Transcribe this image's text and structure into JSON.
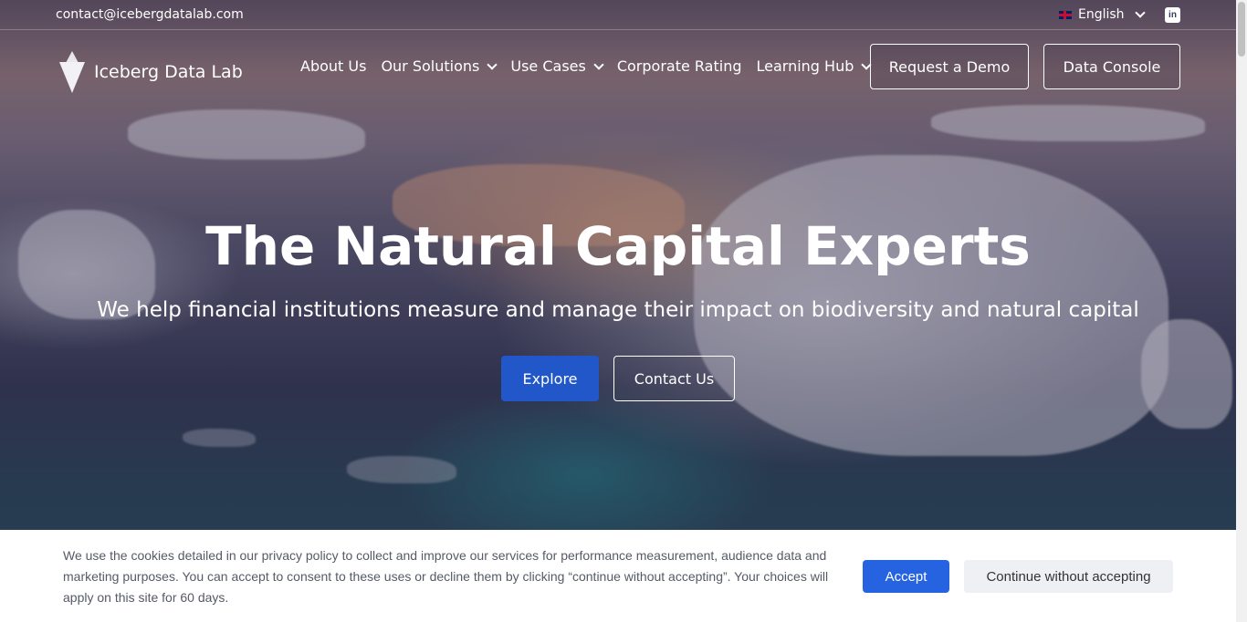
{
  "topbar": {
    "email": "contact@icebergdatalab.com",
    "language": "English",
    "language_flag": "uk-flag-icon",
    "social_icon": "linkedin-icon",
    "linkedin_glyph": "in"
  },
  "logo": {
    "text": "Iceberg Data Lab",
    "icon": "iceberg-logo-icon"
  },
  "nav": {
    "items": [
      {
        "label": "About Us",
        "dropdown": false
      },
      {
        "label": "Our Solutions",
        "dropdown": true
      },
      {
        "label": "Use Cases",
        "dropdown": true
      },
      {
        "label": "Corporate Rating",
        "dropdown": false
      },
      {
        "label": "Learning Hub",
        "dropdown": true
      }
    ],
    "demo_label": "Request a Demo",
    "console_label": "Data Console"
  },
  "hero": {
    "headline": "The Natural Capital Experts",
    "subline": "We help financial institutions measure and manage their impact on biodiversity and natural capital",
    "explore_label": "Explore",
    "contact_label": "Contact Us"
  },
  "cookie": {
    "text": "We use the cookies detailed in our privacy policy to collect and improve our services for performance measurement, audience data and marketing purposes. You can accept to consent to these uses or decline them by clicking “continue without accepting”. Your choices will apply on this site for 60 days.",
    "accept_label": "Accept",
    "decline_label": "Continue without accepting"
  },
  "colors": {
    "primary_button": "#2157c9",
    "accept_button": "#2563e0",
    "decline_button": "#eef0f3"
  }
}
